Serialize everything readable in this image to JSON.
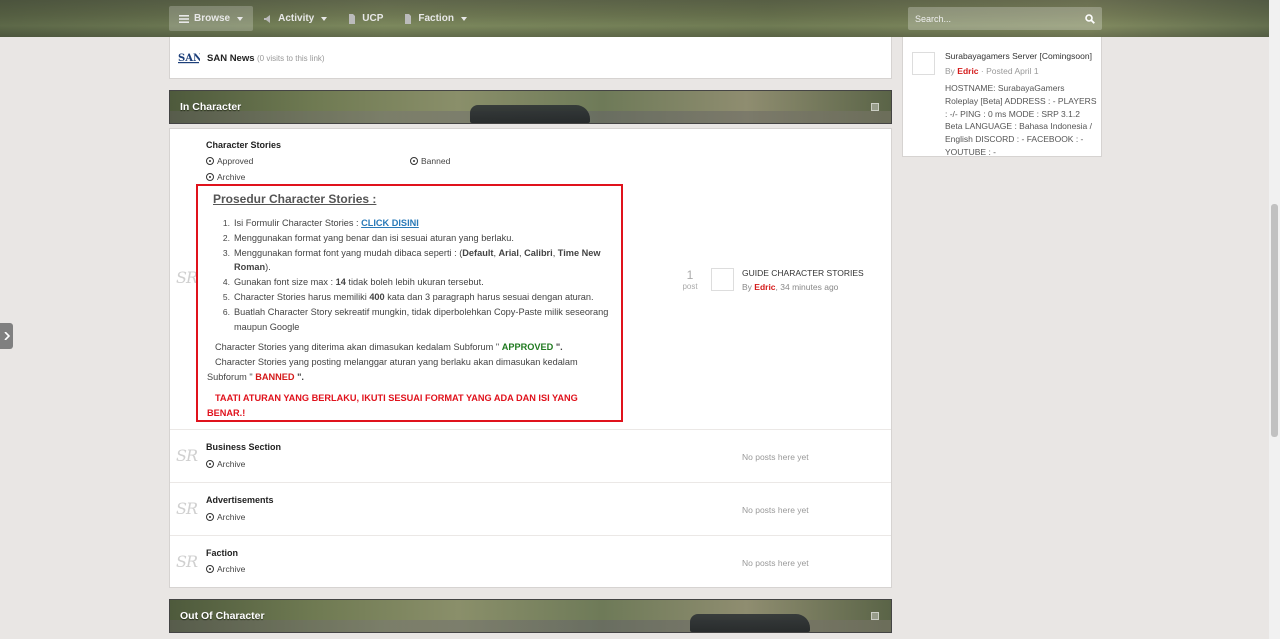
{
  "nav": {
    "browse": "Browse",
    "activity": "Activity",
    "ucp": "UCP",
    "faction": "Faction"
  },
  "search": {
    "placeholder": "Search..."
  },
  "san_news": {
    "name": "SAN News",
    "visits": "(0 visits to this link)"
  },
  "in_character": {
    "title": "In Character",
    "character_stories": {
      "name": "Character Stories",
      "subforums": [
        "Approved",
        "Banned",
        "Archive"
      ],
      "procedure_title": "Prosedur Character Stories :",
      "items": [
        {
          "num": "1.",
          "text": "Isi Formulir Character Stories : ",
          "link": "CLICK DISINI"
        },
        {
          "num": "2.",
          "text": "Menggunakan format yang benar dan isi sesuai aturan yang berlaku."
        },
        {
          "num": "3.",
          "pre": "Menggunakan format font yang mudah dibaca seperti : (",
          "fonts": [
            "Default",
            "Arial",
            "Calibri",
            "Time New Roman"
          ],
          "post": ")."
        },
        {
          "num": "4.",
          "pre": "Gunakan font size max : ",
          "bold": "14",
          "post": " tidak boleh lebih ukuran tersebut."
        },
        {
          "num": "5.",
          "pre": "Character Stories harus memiliki ",
          "bold": "400",
          "post": " kata dan 3 paragraph harus sesuai dengan aturan."
        },
        {
          "num": "6.",
          "text": "Buatlah Character Story sekreatif mungkin, tidak diperbolehkan Copy-Paste milik seseorang maupun Google"
        }
      ],
      "approved_pre": "Character Stories yang diterima akan dimasukan kedalam Subforum \" ",
      "approved_word": "APPROVED",
      "approved_post": " \".",
      "banned_pre": "Character Stories yang posting melanggar aturan yang berlaku akan dimasukan kedalam Subforum \" ",
      "banned_word": "BANNED",
      "banned_post": " \".",
      "warning": "TAATI ATURAN YANG BERLAKU, IKUTI SESUAI FORMAT YANG ADA DAN ISI YANG BENAR.!",
      "post_count": "1",
      "post_label": "post",
      "last_post_title": "GUIDE CHARACTER STORIES",
      "last_post_by": "By ",
      "last_post_author": "Edric",
      "last_post_time": ", 34 minutes ago"
    },
    "business": {
      "name": "Business Section",
      "sub": "Archive",
      "noposts": "No posts here yet"
    },
    "advertisements": {
      "name": "Advertisements",
      "sub": "Archive",
      "noposts": "No posts here yet"
    },
    "faction": {
      "name": "Faction",
      "sub": "Archive",
      "noposts": "No posts here yet"
    }
  },
  "out_of_character": {
    "title": "Out Of Character"
  },
  "sidebar": {
    "title": "Surabayagamers Server [Comingsoon]",
    "by": "By ",
    "author": "Edric",
    "posted": " · Posted April 1",
    "body": "HOSTNAME: SurabayaGamers Roleplay [Beta] ADDRESS : -    PLAYERS : -/- PING : 0 ms MODE : SRP 3.1.2 Beta LANGUAGE : Bahasa Indonesia / English DISCORD : - FACEBOOK : - YOUTUBE : -"
  },
  "forum_icon_text": "SR",
  "colors": {
    "accent_red": "#d41a1a",
    "approved_green": "#1f7a1f",
    "link_blue": "#2a7ab8",
    "highlight_box": "#e0121c"
  }
}
